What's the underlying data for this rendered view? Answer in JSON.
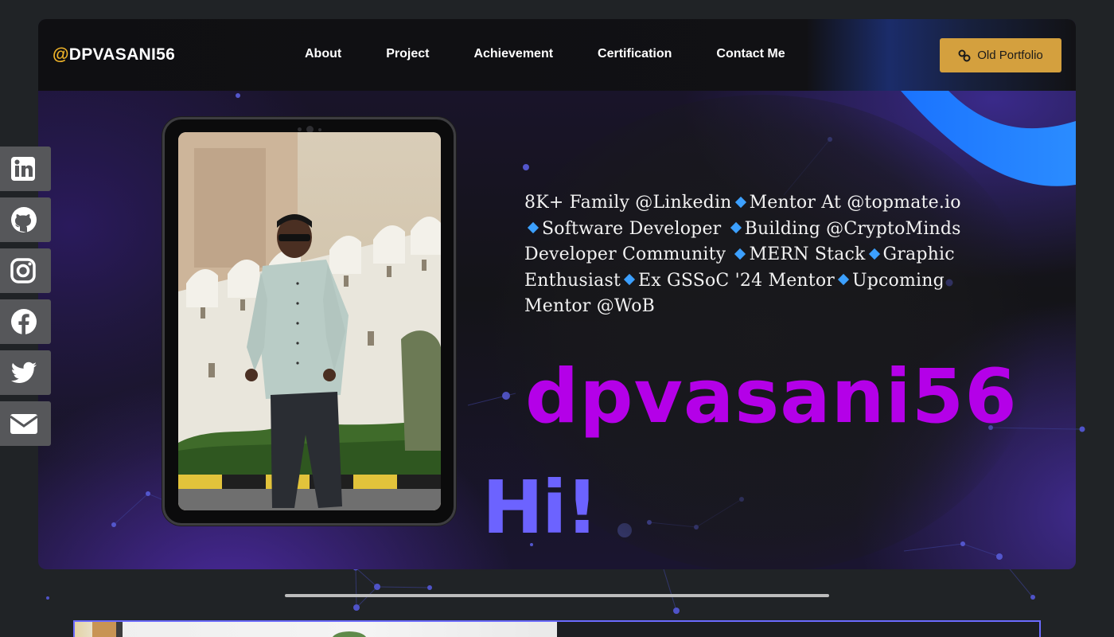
{
  "brand": {
    "at": "@",
    "name": "DPVASANI56"
  },
  "nav": {
    "links": [
      "About",
      "Project",
      "Achievement",
      "Certification",
      "Contact Me"
    ],
    "old_portfolio_label": "Old Portfolio",
    "old_portfolio_icon": "link-icon"
  },
  "hero": {
    "bio_segments": [
      "8K+ Family @Linkedin",
      "Mentor At @topmate.io",
      "Software Developer",
      "Building @CryptoMinds Developer Community",
      "MERN Stack",
      "Graphic Enthusiast",
      "Ex GSSoC '24 Mentor",
      "Upcoming Mentor @WoB"
    ],
    "handle": "dpvasani56",
    "greeting": "Hi!",
    "photo_icon": "profile-photo"
  },
  "social": [
    {
      "name": "linkedin-icon"
    },
    {
      "name": "github-icon"
    },
    {
      "name": "instagram-icon"
    },
    {
      "name": "facebook-icon"
    },
    {
      "name": "twitter-icon"
    },
    {
      "name": "mail-icon"
    }
  ],
  "colors": {
    "page_bg": "#202326",
    "brand_accent": "#f0b429",
    "button_bg": "#d4a03e",
    "handle": "#b400e8",
    "greeting": "#6c63ff",
    "diamond": "#3ca0ff",
    "social_bg": "#56575a"
  }
}
